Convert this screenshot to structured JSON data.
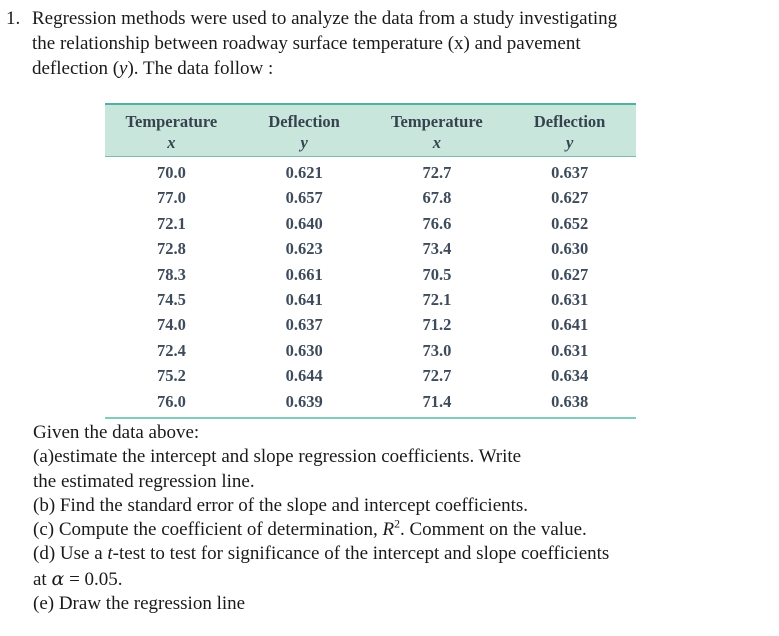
{
  "problem": {
    "number": "1.",
    "text_line_1": "Regression methods were used to analyze the data from a study investigating",
    "text_line_2": "the relationship between roadway surface temperature (x) and pavement",
    "text_line_3_a": "deflection (",
    "text_line_3_var": "y",
    "text_line_3_b": "). The data follow :"
  },
  "table": {
    "headers": [
      {
        "name": "Temperature",
        "variable": "x"
      },
      {
        "name": "Deflection",
        "variable": "y"
      },
      {
        "name": "Temperature",
        "variable": "x"
      },
      {
        "name": "Deflection",
        "variable": "y"
      }
    ],
    "rows": [
      [
        "70.0",
        "0.621",
        "72.7",
        "0.637"
      ],
      [
        "77.0",
        "0.657",
        "67.8",
        "0.627"
      ],
      [
        "72.1",
        "0.640",
        "76.6",
        "0.652"
      ],
      [
        "72.8",
        "0.623",
        "73.4",
        "0.630"
      ],
      [
        "78.3",
        "0.661",
        "70.5",
        "0.627"
      ],
      [
        "74.5",
        "0.641",
        "72.1",
        "0.631"
      ],
      [
        "74.0",
        "0.637",
        "71.2",
        "0.641"
      ],
      [
        "72.4",
        "0.630",
        "73.0",
        "0.631"
      ],
      [
        "75.2",
        "0.644",
        "72.7",
        "0.634"
      ],
      [
        "76.0",
        "0.639",
        "71.4",
        "0.638"
      ]
    ],
    "header_background": "#c9e6dd",
    "rule_color": "#7fcdbb"
  },
  "tasks": {
    "intro": "Given the data above:",
    "a_line1": "(a)estimate the intercept and slope  regression coefficients. Write",
    "a_line2": "the estimated regression line.",
    "b": "(b) Find the standard error of the slope and intercept coefficients.",
    "c_part1": "(c) Compute the coefficient of determination, ",
    "c_symbol": "R",
    "c_exponent": "2",
    "c_part2": ". Comment on the value.",
    "d_part1": "(d) Use a ",
    "d_italic": "t",
    "d_part2": "-test to test for significance of the intercept and slope coefficients",
    "d_line2_pre": "at ",
    "d_line2_alpha": "α",
    "d_line2_post": " = 0.05.",
    "e": "(e) Draw the regression line"
  }
}
